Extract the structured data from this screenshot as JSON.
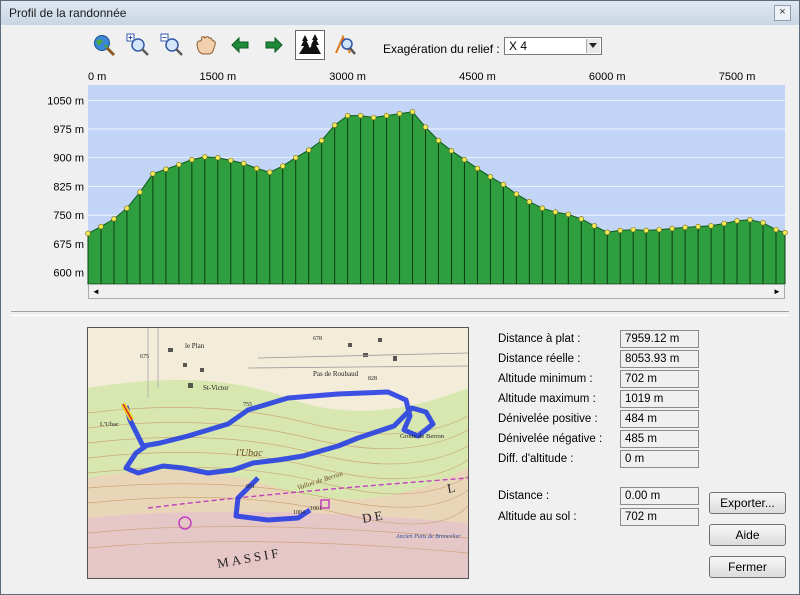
{
  "window": {
    "title": "Profil de la randonnée",
    "close_glyph": "×"
  },
  "toolbar": {
    "buttons": [
      "zoom-globe-icon",
      "zoom-in-icon",
      "zoom-out-icon",
      "pan-hand-icon",
      "arrow-left-icon",
      "arrow-right-icon",
      "vegetation-profile-icon",
      "profile-locate-icon"
    ],
    "relief_label": "Exagération du relief :",
    "relief_value": "X 4"
  },
  "colors": {
    "plot_bg": "#c2d5f6",
    "fill": "#2e9e3e",
    "point": "#f3ec5a",
    "route": "#1c35e6"
  },
  "chart_data": {
    "type": "area",
    "title": "",
    "x_ticks": [
      "0 m",
      "1500 m",
      "3000 m",
      "4500 m",
      "6000 m",
      "7500 m"
    ],
    "y_ticks": [
      "1050 m",
      "975 m",
      "900 m",
      "825 m",
      "750 m",
      "675 m",
      "600 m"
    ],
    "xlim": [
      0,
      8053.93
    ],
    "ylim": [
      570,
      1090
    ],
    "grid": true,
    "x": [
      0,
      150,
      300,
      450,
      600,
      750,
      900,
      1050,
      1200,
      1350,
      1500,
      1650,
      1800,
      1950,
      2100,
      2250,
      2400,
      2550,
      2700,
      2850,
      3000,
      3150,
      3300,
      3450,
      3600,
      3750,
      3900,
      4050,
      4200,
      4350,
      4500,
      4650,
      4800,
      4950,
      5100,
      5250,
      5400,
      5550,
      5700,
      5850,
      6000,
      6150,
      6300,
      6450,
      6600,
      6750,
      6900,
      7050,
      7200,
      7350,
      7500,
      7650,
      7800,
      7950,
      8053.93
    ],
    "y": [
      702,
      720,
      740,
      768,
      810,
      858,
      870,
      882,
      895,
      902,
      900,
      893,
      885,
      872,
      862,
      878,
      900,
      920,
      945,
      985,
      1010,
      1010,
      1005,
      1010,
      1015,
      1020,
      980,
      945,
      918,
      895,
      872,
      850,
      830,
      805,
      785,
      768,
      758,
      752,
      740,
      722,
      705,
      710,
      712,
      710,
      712,
      715,
      718,
      720,
      722,
      728,
      735,
      738,
      730,
      712,
      704
    ]
  },
  "stats": [
    {
      "label": "Distance à plat :",
      "value": "7959.12 m"
    },
    {
      "label": "Distance réelle :",
      "value": "8053.93 m"
    },
    {
      "label": "Altitude minimum :",
      "value": "702 m"
    },
    {
      "label": "Altitude maximum :",
      "value": "1019 m"
    },
    {
      "label": "Dénivelée positive :",
      "value": "484 m"
    },
    {
      "label": "Dénivelée négative :",
      "value": "485 m"
    },
    {
      "label": "Diff. d'altitude :",
      "value": "0 m"
    }
  ],
  "cursor": [
    {
      "label": "Distance :",
      "value": "0.00 m"
    },
    {
      "label": "Altitude au sol :",
      "value": "702 m"
    }
  ],
  "buttons": {
    "export": "Exporter...",
    "help": "Aide",
    "close": "Fermer"
  },
  "map": {
    "labels": [
      "le Plan",
      "St-Victor",
      "Pas de Roubaud",
      "l'Ubac",
      "Grotte de Berron",
      "Vallon de Berron",
      "L'Ubac",
      "MASSIF",
      "DE",
      "L",
      "Ancien Puits de Broncelier",
      "678",
      "755",
      "951",
      "1004",
      "1001",
      "828",
      "675"
    ]
  },
  "scroll": {
    "left_arrow": "◄",
    "right_arrow": "►"
  }
}
